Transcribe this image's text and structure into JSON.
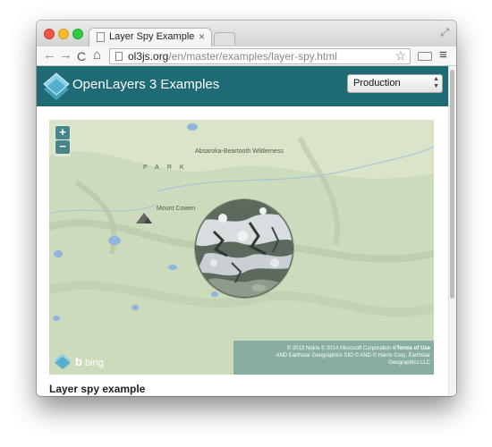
{
  "browser": {
    "tab_title": "Layer Spy Example",
    "tab_close": "×",
    "url_host": "ol3js.org",
    "url_path": "/en/master/examples/layer-spy.html",
    "nav_back": "←",
    "nav_forward": "→",
    "nav_reload": "C",
    "nav_home": "⌂",
    "star": "☆",
    "menu": "≡",
    "fullscreen": "⤢"
  },
  "header": {
    "title": "OpenLayers 3 Examples",
    "mode_select": {
      "value": "Production",
      "arrows": "▲▼"
    }
  },
  "map": {
    "zoom_in": "+",
    "zoom_out": "−",
    "labels": {
      "wilderness": "Absaroka-Beartooth Wilderness",
      "park": "PARK",
      "mountain": "Mount Cowen"
    },
    "attribution": {
      "line1": "© 2013 Nokia © 2014 Microsoft Corporation",
      "terms": "©Terms of Use",
      "line2": "AND Earthstar Geographics SIO © AND © Harris Corp, Earthstar",
      "line3": "Geographics LLC"
    },
    "bing_b": "b",
    "bing_text": "bing"
  },
  "example": {
    "title": "Layer spy example"
  },
  "colors": {
    "header_bg": "#1f6b75",
    "map_bg": "#cfdcc0",
    "water": "#8fb5dc"
  }
}
